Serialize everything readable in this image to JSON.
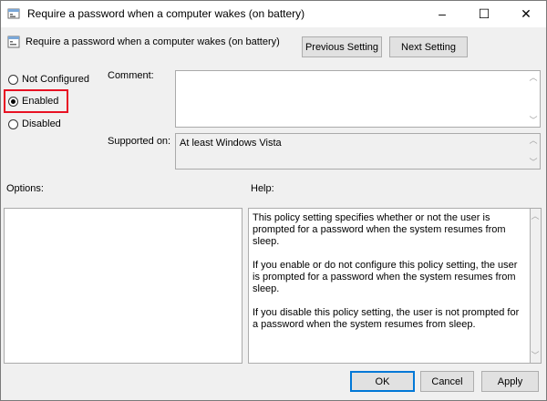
{
  "window": {
    "title": "Require a password when a computer wakes (on battery)",
    "minimize_glyph": "–",
    "maximize_glyph": "☐",
    "close_glyph": "✕"
  },
  "header": {
    "policy_name": "Require a password when a computer wakes (on battery)",
    "previous_label": "Previous Setting",
    "next_label": "Next Setting"
  },
  "state": {
    "options": [
      {
        "label": "Not Configured",
        "selected": false
      },
      {
        "label": "Enabled",
        "selected": true
      },
      {
        "label": "Disabled",
        "selected": false
      }
    ],
    "highlight_color": "#e81123"
  },
  "fields": {
    "comment_label": "Comment:",
    "comment_value": "",
    "supported_label": "Supported on:",
    "supported_value": "At least Windows Vista"
  },
  "sections": {
    "options_label": "Options:",
    "help_label": "Help:"
  },
  "help": {
    "paragraphs": [
      "This policy setting specifies whether or not the user is prompted for a password when the system resumes from sleep.",
      "If you enable or do not configure this policy setting, the user is prompted for a password when the system resumes from sleep.",
      "If you disable this policy setting, the user is not prompted for a password when the system resumes from sleep."
    ]
  },
  "footer": {
    "ok_label": "OK",
    "cancel_label": "Cancel",
    "apply_label": "Apply"
  },
  "colors": {
    "accent": "#0078d7",
    "highlight": "#e81123"
  }
}
